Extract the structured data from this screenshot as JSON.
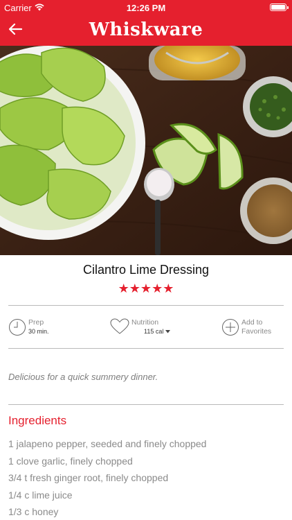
{
  "status_bar": {
    "carrier": "Carrier",
    "time": "12:26 PM"
  },
  "nav": {
    "brand": "Whiskware",
    "back_icon": "arrow-left-icon"
  },
  "hero": {
    "alt": "salad bowl with lettuce, lime wedges, salt spoon, olive oil, herbs and spices"
  },
  "recipe": {
    "title": "Cilantro Lime Dressing",
    "rating": 5,
    "rating_stars": "★★★★★"
  },
  "meta": {
    "prep": {
      "label": "Prep",
      "value": "30 min.",
      "icon": "clock-icon"
    },
    "nutrition": {
      "label": "Nutrition",
      "value": "115 cal",
      "icon": "heart-icon",
      "dropdown_icon": "caret-down-icon"
    },
    "favorites": {
      "label_line1": "Add to",
      "label_line2": "Favorites",
      "icon": "plus-circle-icon"
    }
  },
  "note": "Delicious for a quick summery dinner.",
  "ingredients": {
    "title": "Ingredients",
    "items": [
      "1 jalapeno pepper, seeded and finely chopped",
      "1 clove garlic, finely chopped",
      "3/4 t fresh ginger root, finely chopped",
      "1/4 c lime juice",
      "1/3 c honey"
    ]
  },
  "colors": {
    "brand_red": "#e5202e",
    "muted_text": "#8a8a8a",
    "divider": "#b9b9b9"
  }
}
